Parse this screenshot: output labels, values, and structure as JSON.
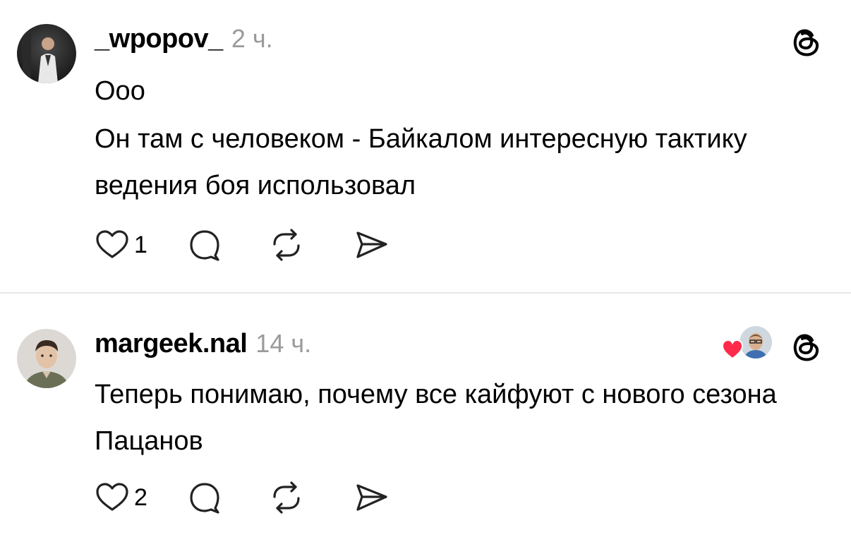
{
  "posts": [
    {
      "username": "_wpopov_",
      "time": "2 ч.",
      "lines": [
        "Ооо",
        "Он там с человеком - Байкалом интересную тактику ведения боя использовал"
      ],
      "likes": "1",
      "avatar_icon": "user-avatar-dark-photo",
      "app_icon": "threads-icon"
    },
    {
      "username": "margeek.nal",
      "time": "14 ч.",
      "lines": [
        "Теперь понимаю, почему все кайфуют с нового сезона Пацанов"
      ],
      "likes": "2",
      "avatar_icon": "user-avatar-photo",
      "app_icon": "threads-icon",
      "liked_by": {
        "icon": "heart-icon",
        "color": "#ff2a4a"
      }
    }
  ],
  "icons": {
    "like": "heart-outline-icon",
    "comment": "comment-bubble-icon",
    "repost": "repost-icon",
    "share": "send-icon"
  }
}
